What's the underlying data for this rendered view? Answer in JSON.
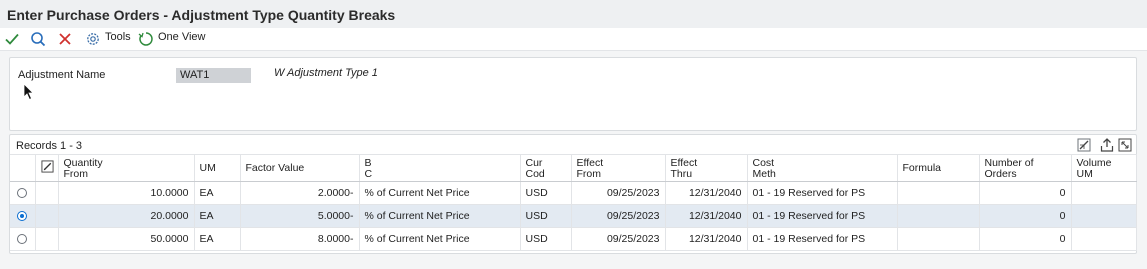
{
  "window": {
    "title": "Enter Purchase Orders - Adjustment Type Quantity Breaks"
  },
  "toolbar": {
    "ok_icon": "checkmark-icon",
    "find_icon": "search-icon",
    "cancel_icon": "close-icon",
    "tools_label": "Tools",
    "one_view_label": "One View",
    "colors": {
      "ok": "#2f8a3c",
      "find": "#2a6ebb",
      "cancel": "#d0312d"
    }
  },
  "header": {
    "adjustment_name_label": "Adjustment Name",
    "adjustment_name_value": "WAT1",
    "adjustment_description": "W Adjustment Type 1"
  },
  "grid": {
    "records_label": "Records 1 - 3",
    "columns": {
      "quantity_from": [
        "Quantity",
        "From"
      ],
      "um": "UM",
      "factor_value": "Factor Value",
      "bc": [
        "B",
        "C"
      ],
      "cur_cod": [
        "Cur",
        "Cod"
      ],
      "effect_from": [
        "Effect",
        "From"
      ],
      "effect_thru": [
        "Effect",
        "Thru"
      ],
      "cost_meth": [
        "Cost",
        "Meth"
      ],
      "formula": "Formula",
      "number_of_orders": [
        "Number of",
        "Orders"
      ],
      "volume_um": [
        "Volume",
        "UM"
      ]
    },
    "rows": [
      {
        "selected": false,
        "quantity_from": "10.0000",
        "um": "EA",
        "factor_value": "2.0000-",
        "bc": "% of Current Net Price",
        "cur_cod": "USD",
        "effect_from": "09/25/2023",
        "effect_thru": "12/31/2040",
        "cost_meth": "01 - 19 Reserved for PS",
        "formula": "",
        "number_of_orders": "0",
        "volume_um": ""
      },
      {
        "selected": true,
        "quantity_from": "20.0000",
        "um": "EA",
        "factor_value": "5.0000-",
        "bc": "% of Current Net Price",
        "cur_cod": "USD",
        "effect_from": "09/25/2023",
        "effect_thru": "12/31/2040",
        "cost_meth": "01 - 19 Reserved for PS",
        "formula": "",
        "number_of_orders": "0",
        "volume_um": ""
      },
      {
        "selected": false,
        "quantity_from": "50.0000",
        "um": "EA",
        "factor_value": "8.0000-",
        "bc": "% of Current Net Price",
        "cur_cod": "USD",
        "effect_from": "09/25/2023",
        "effect_thru": "12/31/2040",
        "cost_meth": "01 - 19 Reserved for PS",
        "formula": "",
        "number_of_orders": "0",
        "volume_um": ""
      }
    ]
  }
}
